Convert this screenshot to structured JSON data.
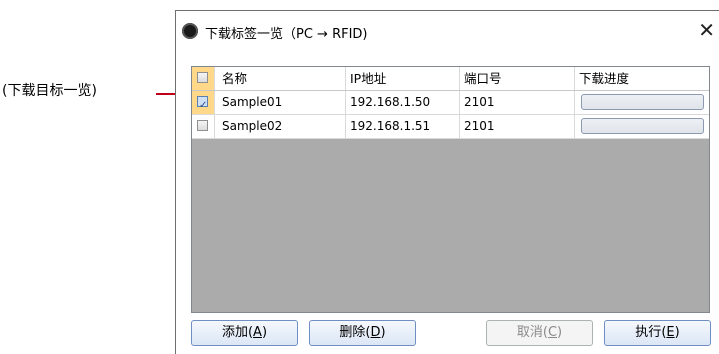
{
  "callout": {
    "label": "(下载目标一览)"
  },
  "window": {
    "title": "下载标签一览（PC → RFID)",
    "close_glyph": "✕"
  },
  "grid": {
    "columns": [
      "名称",
      "IP地址",
      "端口号",
      "下载进度"
    ],
    "header_checkbox_checked": false,
    "rows": [
      {
        "checked": true,
        "name": "Sample01",
        "ip": "192.168.1.50",
        "port": "2101",
        "progress": 0
      },
      {
        "checked": false,
        "name": "Sample02",
        "ip": "192.168.1.51",
        "port": "2101",
        "progress": 0
      }
    ]
  },
  "buttons": {
    "add": {
      "label": "添加",
      "mnemonic": "A"
    },
    "delete": {
      "label": "删除",
      "mnemonic": "D"
    },
    "cancel": {
      "label": "取消",
      "mnemonic": "C",
      "enabled": false
    },
    "execute": {
      "label": "执行",
      "mnemonic": "E"
    }
  },
  "colors": {
    "callout": "#c0001a",
    "selected_checkbox_cell": "#ffd989",
    "grid_empty_area": "#ababab",
    "button_border": "#6f8fc4"
  }
}
